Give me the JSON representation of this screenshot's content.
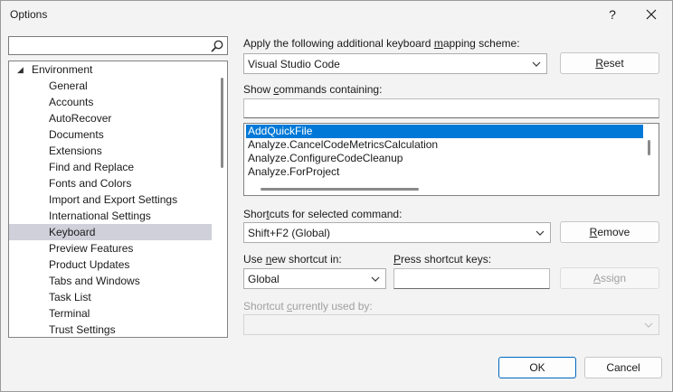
{
  "window": {
    "title": "Options",
    "help_label": "?"
  },
  "search": {
    "value": "",
    "placeholder": ""
  },
  "tree": {
    "root": "Environment",
    "items": [
      "General",
      "Accounts",
      "AutoRecover",
      "Documents",
      "Extensions",
      "Find and Replace",
      "Fonts and Colors",
      "Import and Export Settings",
      "International Settings",
      "Keyboard",
      "Preview Features",
      "Product Updates",
      "Tabs and Windows",
      "Task List",
      "Terminal",
      "Trust Settings"
    ],
    "selected": "Keyboard"
  },
  "mapping": {
    "label_pre": "Apply the following additional keyboard ",
    "label_key": "m",
    "label_post": "apping scheme:",
    "value": "Visual Studio Code",
    "reset_key": "R",
    "reset_rest": "eset"
  },
  "commands": {
    "label_pre": "Show ",
    "label_key": "c",
    "label_post": "ommands containing:",
    "filter_value": "",
    "items": [
      "AddQuickFile",
      "Analyze.CancelCodeMetricsCalculation",
      "Analyze.ConfigureCodeCleanup",
      "Analyze.ForProject"
    ],
    "selected": "AddQuickFile"
  },
  "shortcuts": {
    "label_pre": "Shor",
    "label_key": "t",
    "label_post": "cuts for selected command:",
    "value": "Shift+F2 (Global)",
    "remove_key": "R",
    "remove_rest": "emove"
  },
  "use_in": {
    "label_pre": "Use ",
    "label_key": "n",
    "label_post": "ew shortcut in:",
    "value": "Global"
  },
  "press_keys": {
    "label_key": "P",
    "label_post": "ress shortcut keys:",
    "value": ""
  },
  "assign": {
    "key": "A",
    "rest": "ssign"
  },
  "used_by": {
    "label_pre": "Shortcut ",
    "label_key": "c",
    "label_post": "urrently used by:",
    "value": ""
  },
  "footer": {
    "ok": "OK",
    "cancel": "Cancel"
  },
  "colors": {
    "selection": "#0078d7",
    "tree_selection": "#cfd0da",
    "primary_border": "#0067c0"
  }
}
